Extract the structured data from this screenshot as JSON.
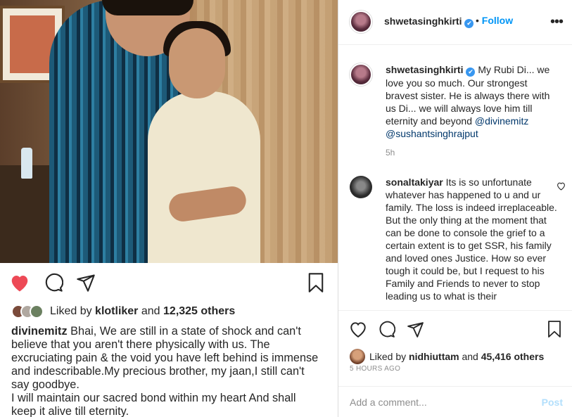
{
  "embedded_post": {
    "liked_by_prefix": "Liked by",
    "liked_by_user": "klotliker",
    "liked_by_and": "and",
    "liked_by_count": "12,325 others",
    "caption_user": "divinemitz",
    "caption_text": "Bhai, We are still in a state of shock and can't believe that you aren't there physically with us. The excruciating pain & the void you have left behind is immense and indescribable.My precious brother, my jaan,I still can't say goodbye.",
    "caption_text2": "I will maintain our sacred bond within my heart And shall keep it alive till eternity.",
    "like_color": "#ed4956"
  },
  "header": {
    "username": "shwetasinghkirti",
    "verified_mark": "✔",
    "separator": "•",
    "follow_label": "Follow",
    "more_label": "•••"
  },
  "caption": {
    "username": "shwetasinghkirti",
    "text": "My Rubi Di... we love you so much. Our strongest bravest sister. He is always there with us Di... we will always love him till eternity and beyond",
    "mention1": "@divinemitz",
    "mention2": "@sushantsinghrajput",
    "time": "5h"
  },
  "comment": {
    "username": "sonaltakiyar",
    "text": "Its is so unfortunate whatever has happened to u and ur family. The loss is indeed irreplaceable. But the only thing at the moment that can be done to console the grief to a certain extent is to get SSR, his family and loved ones Justice. How so ever tough it could be, but I request to his Family and Friends to never to stop leading us to what is their"
  },
  "footer": {
    "liked_by_prefix": "Liked by",
    "liked_by_user": "nidhiuttam",
    "liked_by_and": "and",
    "liked_by_count": "45,416 others",
    "time_ago": "5 HOURS AGO",
    "add_comment_placeholder": "Add a comment...",
    "post_label": "Post"
  },
  "colors": {
    "accent": "#0095f6",
    "link": "#00376b",
    "muted": "#8e8e8e",
    "border": "#dbdbdb"
  }
}
